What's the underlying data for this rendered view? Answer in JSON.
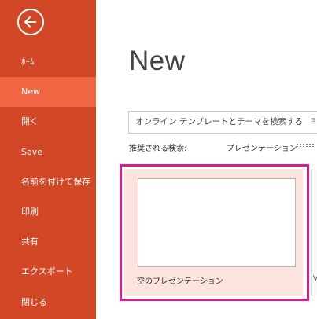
{
  "sidebar": {
    "items": [
      {
        "label": "ﾎｰﾑ"
      },
      {
        "label": "New"
      },
      {
        "label": "開く"
      },
      {
        "label": "Save"
      },
      {
        "label": "名前を付けて保存"
      },
      {
        "label": "印刷"
      },
      {
        "label": "共有"
      },
      {
        "label": "エクスポート"
      },
      {
        "label": "閉じる"
      }
    ],
    "active_index": 1
  },
  "main": {
    "title": "New",
    "search": {
      "value": "オンライン テンプレートとテーマを検索する",
      "icon": "search-icon"
    },
    "suggested_label": "推奨される検索:",
    "suggested_searches": [
      "プレゼンテーション"
    ],
    "templates": [
      {
        "label": "空のプレゼンテーション"
      }
    ]
  },
  "colors": {
    "sidebar": "#d24726",
    "sidebar_active": "#ef6641",
    "template_highlight": "#fbe4de",
    "callout_border": "#d81b8e"
  }
}
